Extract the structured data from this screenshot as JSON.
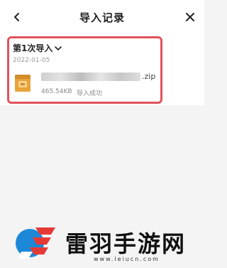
{
  "header": {
    "title": "导入记录",
    "back_icon": "chevron-left-icon",
    "close_icon": "close-icon"
  },
  "import_record": {
    "batch_label": "第1次导入",
    "date": "2022-01-05",
    "file": {
      "name_extension": ".zip",
      "size": "465.54KB",
      "status": "导入成功"
    }
  },
  "watermark": {
    "brand": "雷羽手游网",
    "url": "www.leiucn.com"
  },
  "colors": {
    "highlight_border": "#e0535c",
    "file_icon": "#e8a43a",
    "background": "#f4f4f4"
  }
}
